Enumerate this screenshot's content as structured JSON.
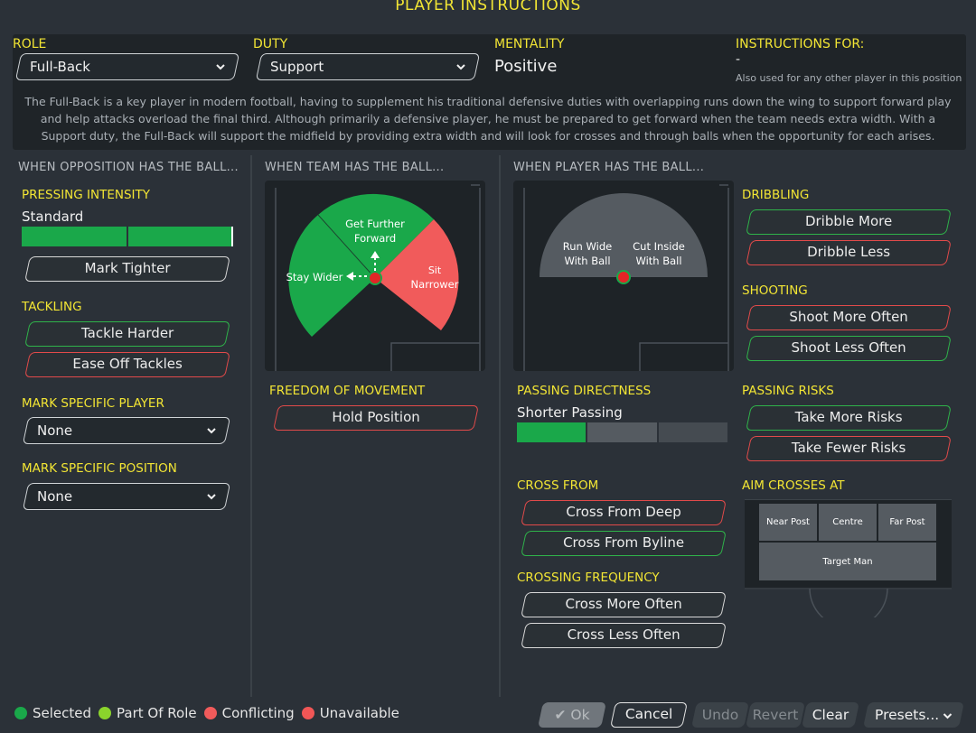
{
  "title": "PLAYER INSTRUCTIONS",
  "role": {
    "label": "ROLE",
    "value": "Full-Back"
  },
  "duty": {
    "label": "DUTY",
    "value": "Support"
  },
  "mentality": {
    "label": "MENTALITY",
    "value": "Positive"
  },
  "instructions_for": {
    "label": "INSTRUCTIONS FOR:",
    "value": "-",
    "note": "Also used for any other player in this position"
  },
  "description": "The Full-Back is a key player in modern football, having to supplement his traditional defensive duties with overlapping runs down the wing to support forward play and help attacks overload the final third. Although primarily a defensive player, he must be prepared to get forward when the team needs extra width. With a Support duty, the Full-Back will support the midfield by providing extra width and will look for crosses and through balls when the opportunity for each arises.",
  "opposition": {
    "header": "WHEN OPPOSITION HAS THE BALL...",
    "pressing_label": "PRESSING INTENSITY",
    "pressing_value": "Standard",
    "pressing_level": 0.67,
    "mark_tighter": "Mark Tighter",
    "tackling_label": "TACKLING",
    "tackle_harder": "Tackle Harder",
    "ease_off": "Ease Off Tackles",
    "mark_player_label": "MARK SPECIFIC PLAYER",
    "mark_player_value": "None",
    "mark_position_label": "MARK SPECIFIC POSITION",
    "mark_position_value": "None"
  },
  "team": {
    "header": "WHEN TEAM HAS THE BALL...",
    "get_further_forward": [
      "Get Further",
      "Forward"
    ],
    "stay_wider": "Stay Wider",
    "sit_narrower": [
      "Sit",
      "Narrower"
    ],
    "freedom_label": "FREEDOM OF MOVEMENT",
    "hold_position": "Hold Position"
  },
  "player": {
    "header": "WHEN PLAYER HAS THE BALL...",
    "run_wide": [
      "Run Wide",
      "With Ball"
    ],
    "cut_inside": [
      "Cut Inside",
      "With Ball"
    ],
    "dribbling_label": "DRIBBLING",
    "dribble_more": "Dribble More",
    "dribble_less": "Dribble Less",
    "shooting_label": "SHOOTING",
    "shoot_more": "Shoot More Often",
    "shoot_less": "Shoot Less Often",
    "passing_dir_label": "PASSING DIRECTNESS",
    "passing_dir_value": "Shorter Passing",
    "passing_dir_level": 0.33,
    "passing_risks_label": "PASSING RISKS",
    "more_risks": "Take More Risks",
    "fewer_risks": "Take Fewer Risks",
    "cross_from_label": "CROSS FROM",
    "cross_deep": "Cross From Deep",
    "cross_byline": "Cross From Byline",
    "aim_label": "AIM CROSSES AT",
    "near_post": "Near Post",
    "centre": "Centre",
    "far_post": "Far Post",
    "target_man": "Target Man",
    "cross_freq_label": "CROSSING FREQUENCY",
    "cross_more": "Cross More Often",
    "cross_less": "Cross Less Often"
  },
  "legend": {
    "selected": "Selected",
    "part_of_role": "Part Of Role",
    "conflicting": "Conflicting",
    "unavailable": "Unavailable"
  },
  "footer": {
    "ok": "Ok",
    "cancel": "Cancel",
    "undo": "Undo",
    "revert": "Revert",
    "clear": "Clear",
    "presets": "Presets..."
  },
  "colors": {
    "accent_yellow": "#f2e534",
    "selected_green": "#1aa84a",
    "part_of_role": "#8bd42c",
    "conflicting": "#f15b5b",
    "unavailable": "#f05656"
  }
}
